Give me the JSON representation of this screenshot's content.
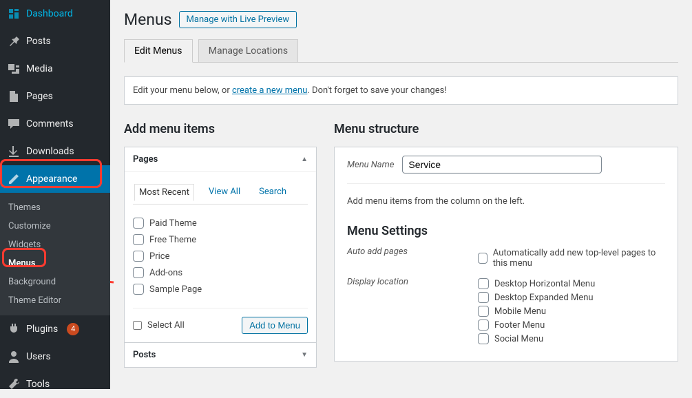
{
  "sidebar": {
    "items": [
      {
        "label": "Dashboard",
        "icon": "dashboard"
      },
      {
        "label": "Posts",
        "icon": "pin"
      },
      {
        "label": "Media",
        "icon": "media"
      },
      {
        "label": "Pages",
        "icon": "pages"
      },
      {
        "label": "Comments",
        "icon": "comments"
      },
      {
        "label": "Downloads",
        "icon": "downloads"
      },
      {
        "label": "Appearance",
        "icon": "appearance",
        "active": true
      },
      {
        "label": "Plugins",
        "icon": "plugins",
        "badge": "4"
      },
      {
        "label": "Users",
        "icon": "users"
      },
      {
        "label": "Tools",
        "icon": "tools"
      }
    ],
    "submenu": [
      {
        "label": "Themes"
      },
      {
        "label": "Customize"
      },
      {
        "label": "Widgets"
      },
      {
        "label": "Menus",
        "active": true
      },
      {
        "label": "Background"
      },
      {
        "label": "Theme Editor"
      }
    ]
  },
  "header": {
    "title": "Menus",
    "action": "Manage with Live Preview"
  },
  "tabs": [
    {
      "label": "Edit Menus",
      "active": true
    },
    {
      "label": "Manage Locations"
    }
  ],
  "notice": {
    "pre": "Edit your menu below, or ",
    "link": "create a new menu",
    "post": ". Don't forget to save your changes!"
  },
  "left": {
    "heading": "Add menu items",
    "pages": {
      "title": "Pages",
      "tabs": [
        {
          "label": "Most Recent",
          "active": true
        },
        {
          "label": "View All"
        },
        {
          "label": "Search"
        }
      ],
      "items": [
        "Paid Theme",
        "Free Theme",
        "Price",
        "Add-ons",
        "Sample Page"
      ],
      "select_all": "Select All",
      "add_button": "Add to Menu"
    },
    "posts": {
      "title": "Posts"
    }
  },
  "right": {
    "heading": "Menu structure",
    "name_label": "Menu Name",
    "name_value": "Service",
    "hint": "Add menu items from the column on the left.",
    "settings_heading": "Menu Settings",
    "auto_label": "Auto add pages",
    "auto_option": "Automatically add new top-level pages to this menu",
    "display_label": "Display location",
    "display_options": [
      "Desktop Horizontal Menu",
      "Desktop Expanded Menu",
      "Mobile Menu",
      "Footer Menu",
      "Social Menu"
    ]
  }
}
